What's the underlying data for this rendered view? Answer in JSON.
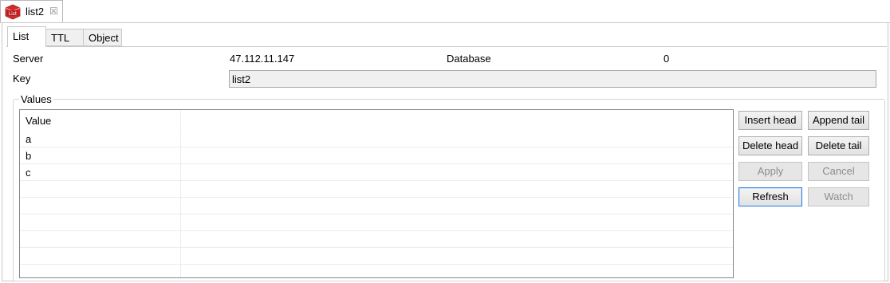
{
  "editor_tab": {
    "label": "list2",
    "icon_text": "List"
  },
  "inner_tabs": [
    {
      "label": "List",
      "active": true
    },
    {
      "label": "TTL",
      "active": false
    },
    {
      "label": "Object",
      "active": false
    }
  ],
  "form": {
    "server_label": "Server",
    "server_value": "47.112.11.147",
    "database_label": "Database",
    "database_value": "0",
    "key_label": "Key",
    "key_value": "list2"
  },
  "values": {
    "group_label": "Values",
    "column_header": "Value",
    "rows": [
      "a",
      "b",
      "c"
    ]
  },
  "buttons": {
    "insert_head": "Insert head",
    "append_tail": "Append tail",
    "delete_head": "Delete head",
    "delete_tail": "Delete tail",
    "apply": "Apply",
    "cancel": "Cancel",
    "refresh": "Refresh",
    "watch": "Watch"
  },
  "colors": {
    "icon_red": "#d2292a"
  }
}
